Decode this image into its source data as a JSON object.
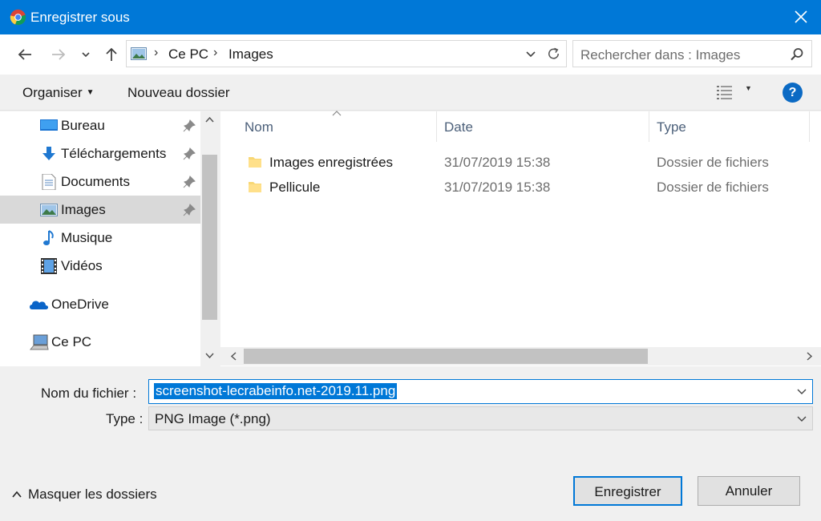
{
  "window": {
    "title": "Enregistrer sous"
  },
  "address": {
    "breadcrumbs": [
      "Ce PC",
      "Images"
    ]
  },
  "search": {
    "placeholder": "Rechercher dans : Images"
  },
  "toolbar": {
    "organise_label": "Organiser",
    "new_folder_label": "Nouveau dossier",
    "help_label": "?"
  },
  "sidebar": {
    "items": [
      {
        "label": "Bureau",
        "icon": "desktop-icon",
        "pinned": true
      },
      {
        "label": "Téléchargements",
        "icon": "download-icon",
        "pinned": true
      },
      {
        "label": "Documents",
        "icon": "document-icon",
        "pinned": true
      },
      {
        "label": "Images",
        "icon": "pictures-icon",
        "pinned": true,
        "selected": true
      },
      {
        "label": "Musique",
        "icon": "music-icon",
        "pinned": false
      },
      {
        "label": "Vidéos",
        "icon": "video-icon",
        "pinned": false
      },
      {
        "label": "OneDrive",
        "icon": "onedrive-icon",
        "pinned": false
      },
      {
        "label": "Ce PC",
        "icon": "computer-icon",
        "pinned": false
      }
    ]
  },
  "filelist": {
    "columns": [
      "Nom",
      "Date",
      "Type"
    ],
    "rows": [
      {
        "name": "Images enregistrées",
        "date": "31/07/2019 15:38",
        "type": "Dossier de fichiers"
      },
      {
        "name": "Pellicule",
        "date": "31/07/2019 15:38",
        "type": "Dossier de fichiers"
      }
    ]
  },
  "form": {
    "filename_label": "Nom du fichier :",
    "filename_value": "screenshot-lecrabeinfo.net-2019.11.png",
    "type_label": "Type :",
    "type_value": "PNG Image (*.png)"
  },
  "footer": {
    "hide_folders_label": "Masquer les dossiers",
    "save_label": "Enregistrer",
    "cancel_label": "Annuler"
  },
  "colors": {
    "accent": "#0078d7",
    "selection": "#d9d9d9"
  }
}
